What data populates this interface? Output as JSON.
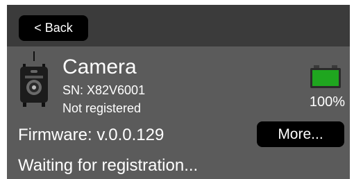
{
  "header": {
    "back_label": "< Back"
  },
  "device": {
    "icon": "trail-camera-icon",
    "name": "Camera",
    "serial": "SN: X82V6001",
    "registration": "Not registered"
  },
  "battery": {
    "icon": "battery-icon",
    "percent_label": "100%",
    "level": 1.0,
    "fill_color": "#1fa61f"
  },
  "firmware": {
    "label": "Firmware: v.0.0.129",
    "more_label": "More..."
  },
  "status": {
    "text": "Waiting for registration..."
  },
  "colors": {
    "screen_bg": "#5b5b5b",
    "header_bg": "#3b3b3b",
    "button_bg": "#000000",
    "text": "#ffffff"
  }
}
